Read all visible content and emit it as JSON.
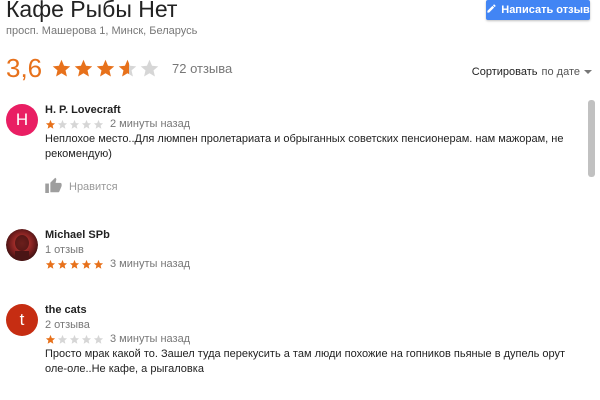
{
  "place": {
    "title": "Кафе Рыбы Нет",
    "address": "просп. Машерова 1, Минск, Беларусь",
    "rating": "3,6",
    "rating_value": 3.6,
    "reviews_count": "72 отзыва"
  },
  "header": {
    "write_review_label": "Написать отзыв",
    "write_icon": "pencil-icon"
  },
  "sort": {
    "label": "Сортировать",
    "value": "по дате"
  },
  "reviews": [
    {
      "author": "H. P. Lovecraft",
      "avatar_letter": "H",
      "avatar_color": "#e91e63",
      "sub": "",
      "stars": 1,
      "time": "2 минуты назад",
      "text": "Неплохое место..Для люмпен пролетариата и обрыганных советских пенсионерам. нам мажорам, не рекомендую)",
      "like_label": "Нравится"
    },
    {
      "author": "Michael SPb",
      "avatar_letter": "",
      "avatar_color": "#6b2a2a",
      "sub": "1 отзыв",
      "stars": 5,
      "time": "3 минуты назад",
      "text": ""
    },
    {
      "author": "the cats",
      "avatar_letter": "t",
      "avatar_color": "#c62d12",
      "sub": "2 отзыва",
      "stars": 1,
      "time": "3 минуты назад",
      "text": "Просто мрак какой то. Зашел туда перекусить а там люди похожие на гопников пьяные в дупель орут оле-оле..Не кафе, а рыгаловка"
    }
  ],
  "colors": {
    "star_filled": "#e7711b",
    "star_empty": "#d6d6d6",
    "button": "#4285f4"
  }
}
